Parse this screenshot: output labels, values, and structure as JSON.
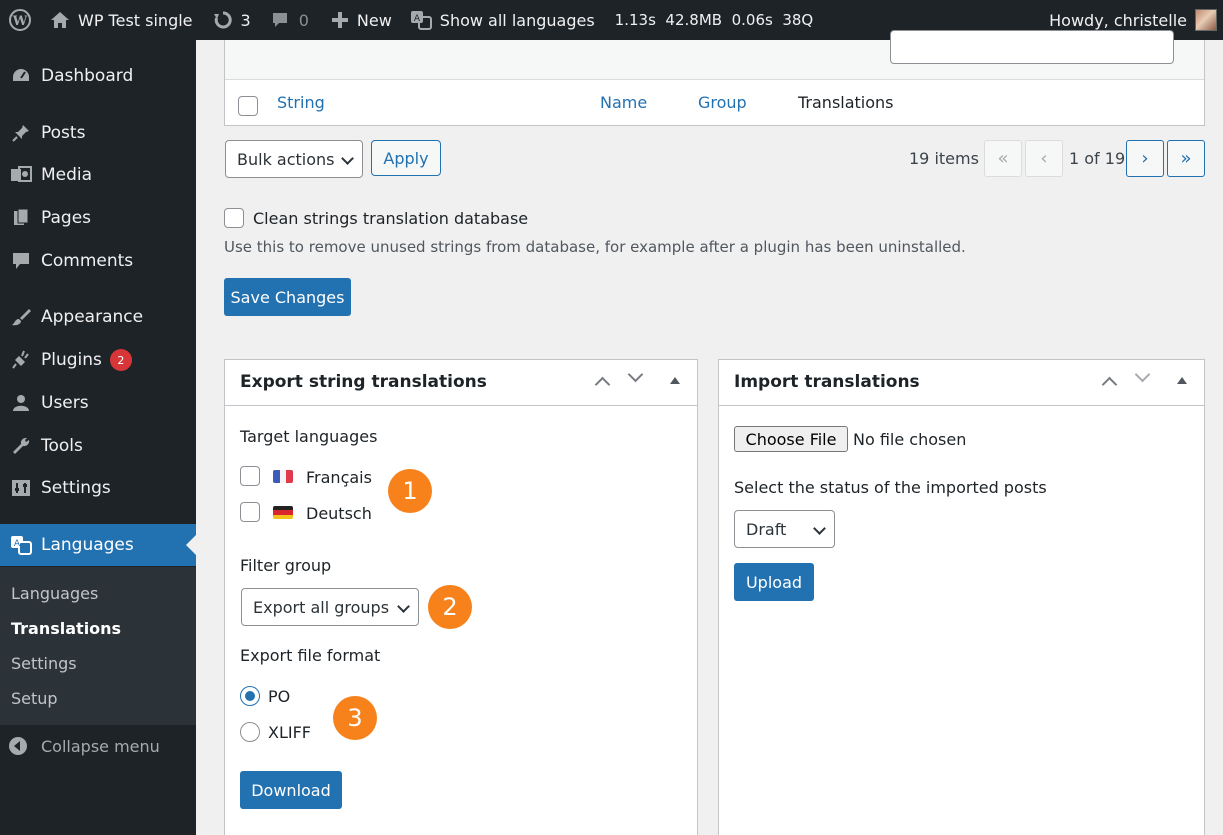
{
  "adminbar": {
    "site_name": "WP Test single",
    "updates_count": "3",
    "comments_count": "0",
    "new_label": "New",
    "languages_label": "Show all languages",
    "perf": "1.13s  42.8MB  0.06s  38Q",
    "greeting": "Howdy, christelle"
  },
  "sidebar": {
    "items": [
      {
        "label": "Dashboard",
        "icon": "dashboard-icon"
      },
      {
        "label": "Posts",
        "icon": "pin-icon"
      },
      {
        "label": "Media",
        "icon": "media-icon"
      },
      {
        "label": "Pages",
        "icon": "pages-icon"
      },
      {
        "label": "Comments",
        "icon": "comments-icon"
      },
      {
        "label": "Appearance",
        "icon": "brush-icon"
      },
      {
        "label": "Plugins",
        "icon": "plugin-icon",
        "badge": "2"
      },
      {
        "label": "Users",
        "icon": "user-icon"
      },
      {
        "label": "Tools",
        "icon": "wrench-icon"
      },
      {
        "label": "Settings",
        "icon": "settings-icon"
      },
      {
        "label": "Languages",
        "icon": "translate-icon"
      }
    ],
    "submenu": [
      "Languages",
      "Translations",
      "Settings",
      "Setup"
    ],
    "collapse_label": "Collapse menu"
  },
  "table": {
    "columns": [
      "String",
      "Name",
      "Group",
      "Translations"
    ]
  },
  "tablenav": {
    "bulk_actions": "Bulk actions",
    "apply": "Apply",
    "items": "19 items",
    "page_info": "1 of 19",
    "first": "«",
    "prev": "‹",
    "next": "›",
    "last": "»"
  },
  "clean": {
    "label": "Clean strings translation database",
    "description": "Use this to remove unused strings from database, for example after a plugin has been uninstalled."
  },
  "save_button": "Save Changes",
  "export_box": {
    "title": "Export string translations",
    "target_label": "Target languages",
    "languages": [
      "Français",
      "Deutsch"
    ],
    "filter_label": "Filter group",
    "filter_value": "Export all groups",
    "format_label": "Export file format",
    "formats": [
      "PO",
      "XLIFF"
    ],
    "selected_format": "PO",
    "download": "Download",
    "markers": [
      "1",
      "2",
      "3"
    ]
  },
  "import_box": {
    "title": "Import translations",
    "choose_file": "Choose File",
    "no_file": "No file chosen",
    "status_label": "Select the status of the imported posts",
    "status_value": "Draft",
    "upload": "Upload"
  },
  "colors": {
    "accent": "#2271b1",
    "adminbar": "#1d2327",
    "marker": "#f7821b",
    "badge": "#d63638"
  }
}
